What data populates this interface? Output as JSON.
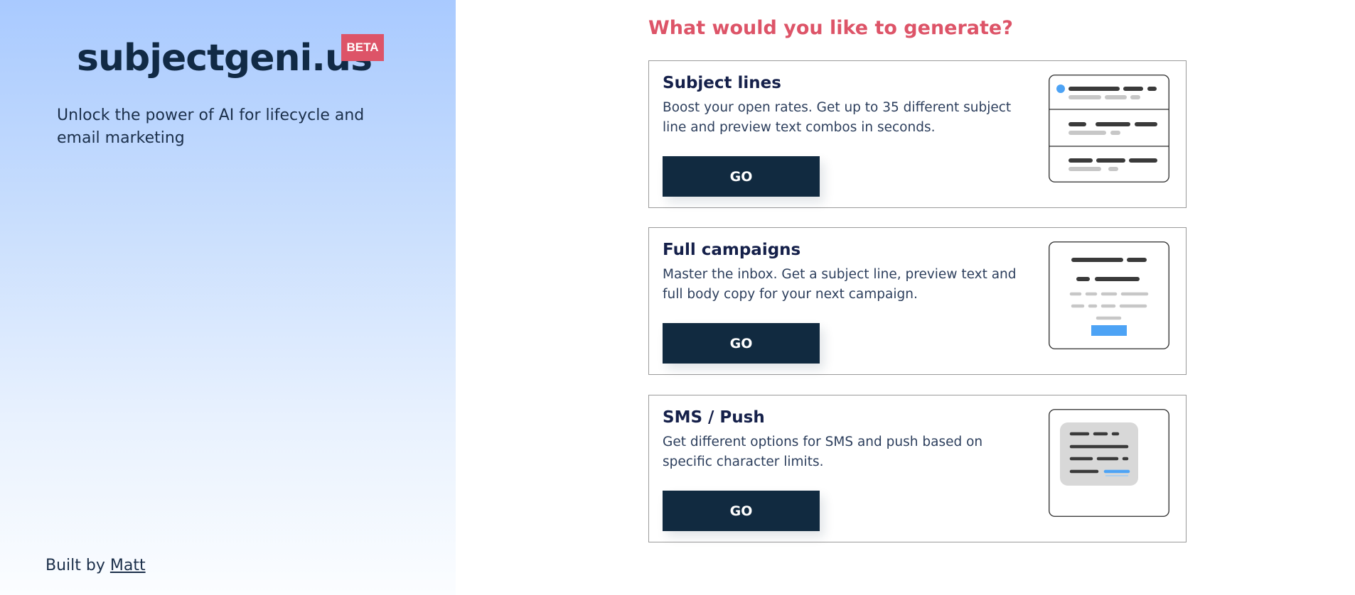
{
  "sidebar": {
    "brand": "subjectgeni.us",
    "badge": "BETA",
    "tagline": "Unlock the power of AI for lifecycle and email marketing",
    "built_prefix": "Built by",
    "built_link": "Matt"
  },
  "main": {
    "heading": "What would you like to generate?",
    "cards": [
      {
        "title": "Subject lines",
        "description": "Boost your open rates. Get up to 35 different subject line and preview text combos in seconds.",
        "button": "GO",
        "icon": "subject-lines-illustration-icon"
      },
      {
        "title": "Full campaigns",
        "description": "Master the inbox. Get a subject line, preview text and full body copy for your next campaign.",
        "button": "GO",
        "icon": "email-campaign-illustration-icon"
      },
      {
        "title": "SMS / Push",
        "description": "Get different options for SMS and push based on specific character limits.",
        "button": "GO",
        "icon": "sms-push-illustration-icon"
      }
    ]
  },
  "colors": {
    "navy": "#112a40",
    "accent": "#dd5468",
    "sidebar_top": "#a9caff",
    "sidebar_bottom": "#fbfdff",
    "highlight_blue": "#4da3f5"
  }
}
